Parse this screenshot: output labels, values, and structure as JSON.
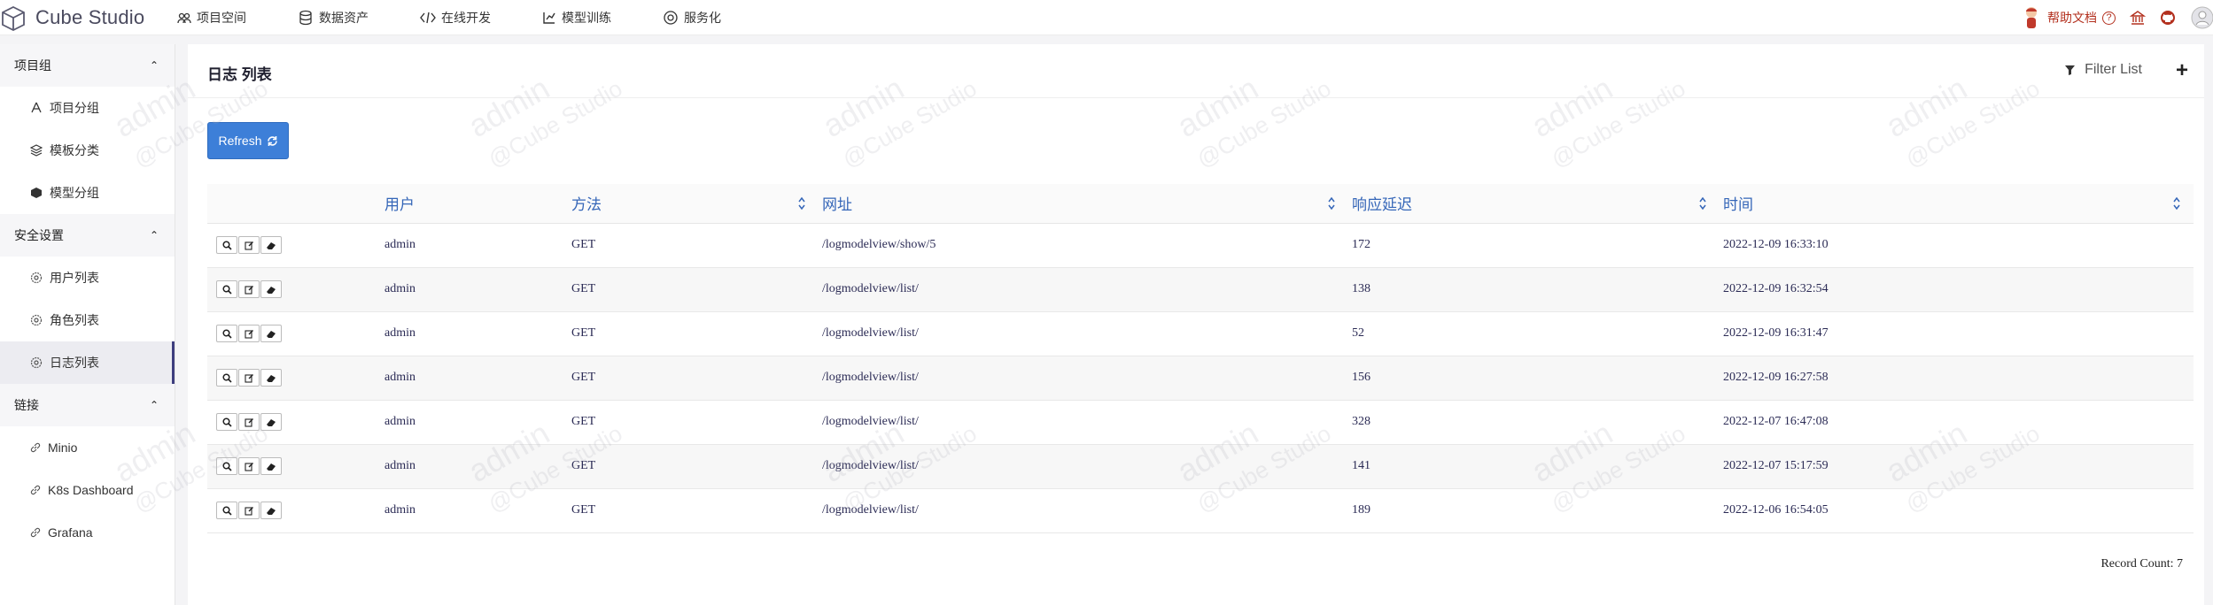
{
  "brand": {
    "name": "Cube Studio"
  },
  "topnav": [
    {
      "label": "项目空间",
      "icon": "team-icon"
    },
    {
      "label": "数据资产",
      "icon": "database-icon"
    },
    {
      "label": "在线开发",
      "icon": "code-icon"
    },
    {
      "label": "模型训练",
      "icon": "train-icon"
    },
    {
      "label": "服务化",
      "icon": "service-icon"
    }
  ],
  "topright": {
    "help_label": "帮助文档"
  },
  "sidebar": {
    "groups": [
      {
        "title": "项目组",
        "items": [
          "项目分组",
          "模板分类",
          "模型分组"
        ]
      },
      {
        "title": "安全设置",
        "items": [
          "用户列表",
          "角色列表",
          "日志列表"
        ]
      },
      {
        "title": "链接",
        "items": [
          "Minio",
          "K8s Dashboard",
          "Grafana"
        ]
      }
    ],
    "active": "日志列表"
  },
  "main": {
    "title": "日志 列表",
    "filter_label": "Filter List",
    "refresh_label": "Refresh",
    "columns": [
      "用户",
      "方法",
      "网址",
      "响应延迟",
      "时间"
    ],
    "rows": [
      [
        "admin",
        "GET",
        "/logmodelview/show/5",
        "172",
        "2022-12-09 16:33:10"
      ],
      [
        "admin",
        "GET",
        "/logmodelview/list/",
        "138",
        "2022-12-09 16:32:54"
      ],
      [
        "admin",
        "GET",
        "/logmodelview/list/",
        "52",
        "2022-12-09 16:31:47"
      ],
      [
        "admin",
        "GET",
        "/logmodelview/list/",
        "156",
        "2022-12-09 16:27:58"
      ],
      [
        "admin",
        "GET",
        "/logmodelview/list/",
        "328",
        "2022-12-07 16:47:08"
      ],
      [
        "admin",
        "GET",
        "/logmodelview/list/",
        "141",
        "2022-12-07 15:17:59"
      ],
      [
        "admin",
        "GET",
        "/logmodelview/list/",
        "189",
        "2022-12-06 16:54:05"
      ]
    ],
    "record_count_label": "Record Count:",
    "record_count": "7"
  },
  "watermark": {
    "line1": "admin",
    "line2": "@Cube Studio"
  },
  "colors": {
    "accent": "#3d7fd8",
    "help": "#b3301e",
    "header_text": "#3566b8"
  }
}
